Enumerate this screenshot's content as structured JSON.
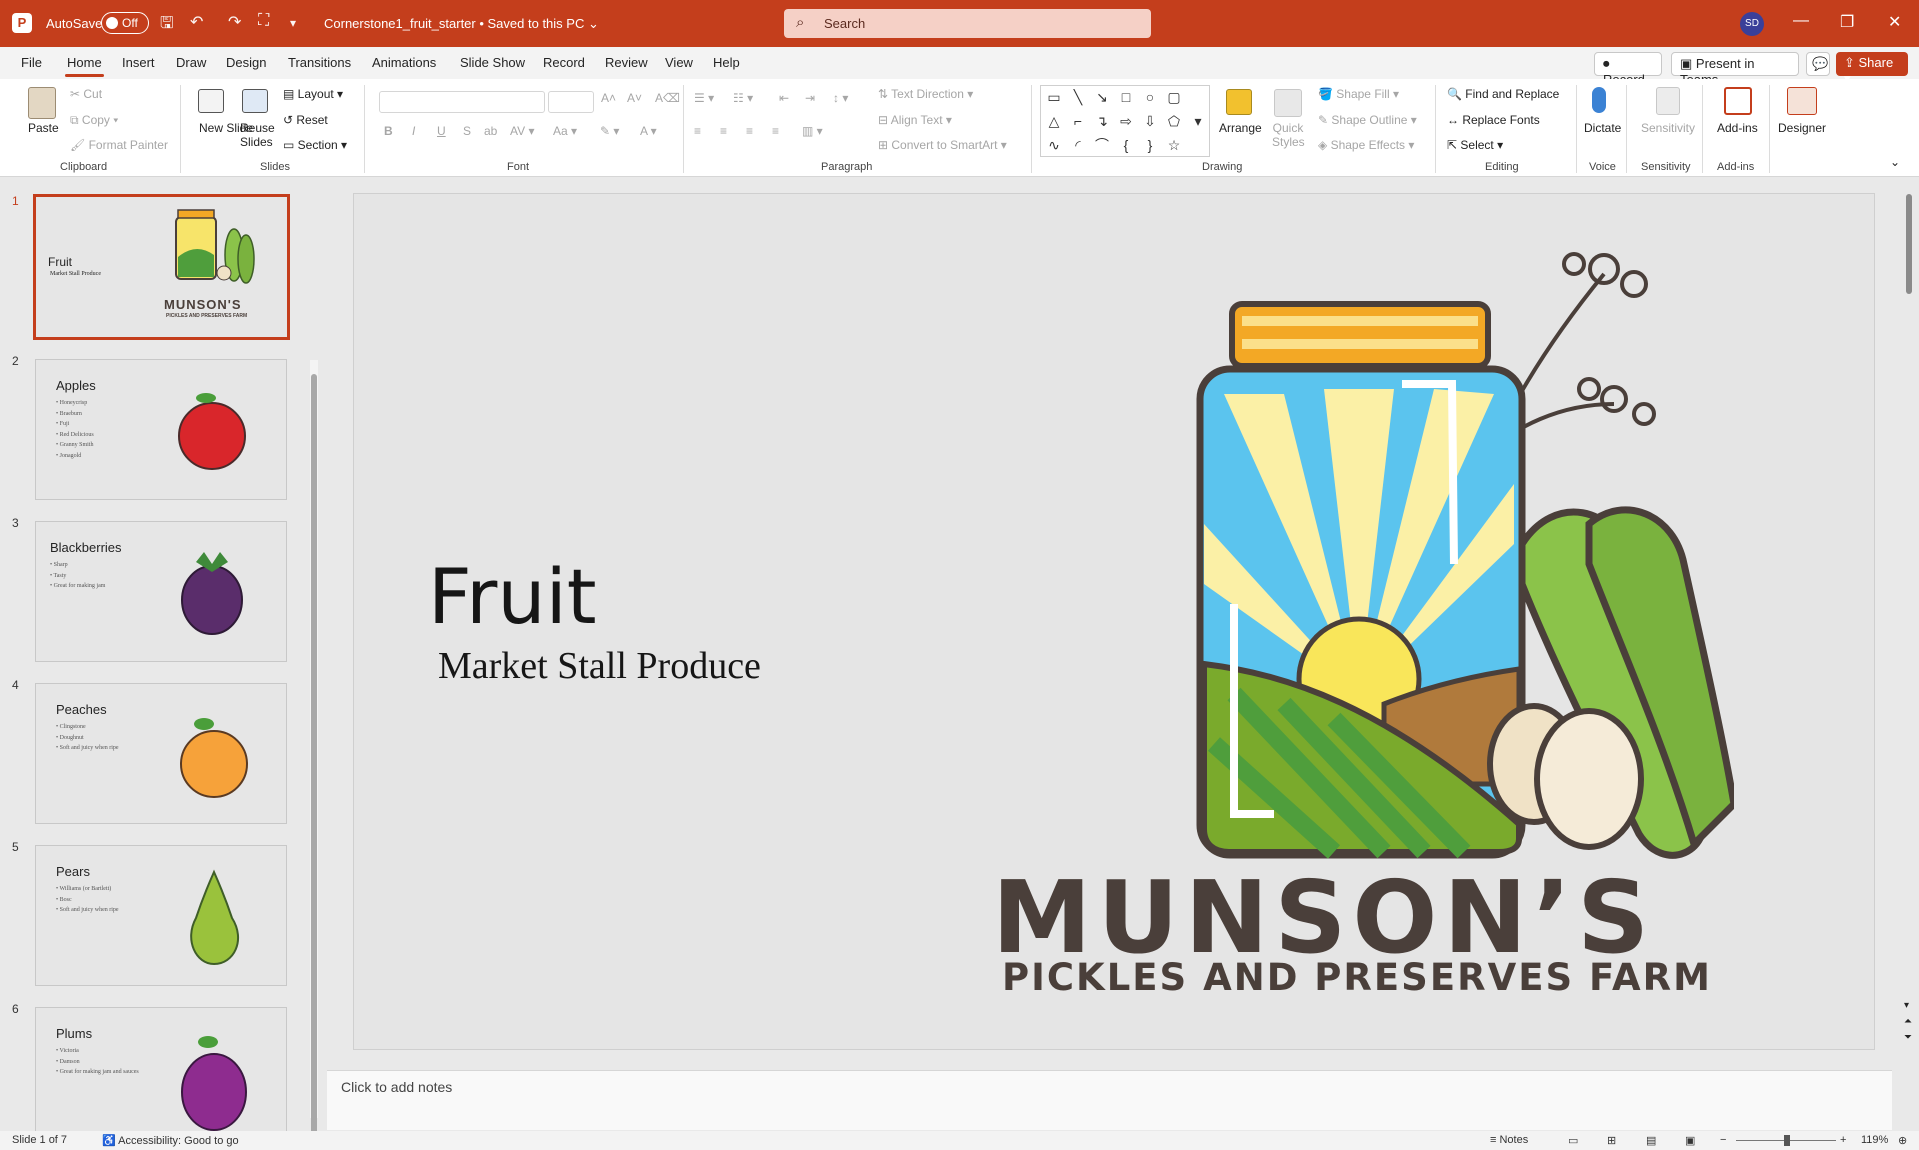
{
  "titlebar": {
    "app_letter": "P",
    "autosave": "AutoSave",
    "toggle": "Off",
    "doc_title": "Cornerstone1_fruit_starter • Saved to this PC",
    "search": "Search",
    "user_initials": "SD"
  },
  "tabs": [
    "File",
    "Home",
    "Insert",
    "Draw",
    "Design",
    "Transitions",
    "Animations",
    "Slide Show",
    "Record",
    "Review",
    "View",
    "Help"
  ],
  "menubar_right": {
    "record": "Record",
    "present": "Present in Teams",
    "share": "Share"
  },
  "ribbon": {
    "clipboard": {
      "paste": "Paste",
      "cut": "Cut",
      "copy": "Copy",
      "format_painter": "Format Painter",
      "group": "Clipboard"
    },
    "slides": {
      "new_slide": "New Slide",
      "reuse": "Reuse Slides",
      "layout": "Layout",
      "reset": "Reset",
      "section": "Section",
      "group": "Slides"
    },
    "font": {
      "group": "Font"
    },
    "paragraph": {
      "text_direction": "Text Direction",
      "align_text": "Align Text",
      "smartart": "Convert to SmartArt",
      "group": "Paragraph"
    },
    "drawing": {
      "arrange": "Arrange",
      "quick_styles": "Quick Styles",
      "shape_fill": "Shape Fill",
      "shape_outline": "Shape Outline",
      "shape_effects": "Shape Effects",
      "group": "Drawing"
    },
    "editing": {
      "find": "Find and Replace",
      "replace_fonts": "Replace Fonts",
      "select": "Select",
      "group": "Editing"
    },
    "voice": {
      "dictate": "Dictate",
      "group": "Voice"
    },
    "sensitivity": {
      "label": "Sensitivity",
      "group": "Sensitivity"
    },
    "addins": {
      "label": "Add-ins",
      "group": "Add-ins"
    },
    "designer": {
      "label": "Designer"
    }
  },
  "slides": [
    {
      "num": "1",
      "title": "Fruit",
      "sub": "Market Stall Produce",
      "logo": "MUNSON'S",
      "logo_sub": "PICKLES AND PRESERVES FARM"
    },
    {
      "num": "2",
      "title": "Apples",
      "bullets": [
        "Honeycrisp",
        "Braeburn",
        "Fuji",
        "Red Delicious",
        "Granny Smith",
        "Jonagold"
      ],
      "color": "#d9262b"
    },
    {
      "num": "3",
      "title": "Blackberries",
      "bullets": [
        "Sharp",
        "Tasty",
        "Great for making jam"
      ],
      "color": "#5a2d6b"
    },
    {
      "num": "4",
      "title": "Peaches",
      "bullets": [
        "Clingstone",
        "Doughnut",
        "Soft and juicy when ripe"
      ],
      "color": "#f6a23a"
    },
    {
      "num": "5",
      "title": "Pears",
      "bullets": [
        "Williams (or Bartlett)",
        "Bosc",
        "Soft and juicy when ripe"
      ],
      "color": "#9ac23c"
    },
    {
      "num": "6",
      "title": "Plums",
      "bullets": [
        "Victoria",
        "Damson",
        "Great for making jam and sauces"
      ],
      "color": "#8e2c8f"
    }
  ],
  "main_slide": {
    "title": "Fruit",
    "subtitle": "Market Stall Produce",
    "logo_main": "MUNSON’S",
    "logo_sub": "PICKLES AND PRESERVES FARM"
  },
  "notes": {
    "placeholder": "Click to add notes"
  },
  "status": {
    "slide": "Slide 1 of 7",
    "accessibility": "Accessibility: Good to go",
    "notes": "Notes",
    "zoom": "119%"
  }
}
